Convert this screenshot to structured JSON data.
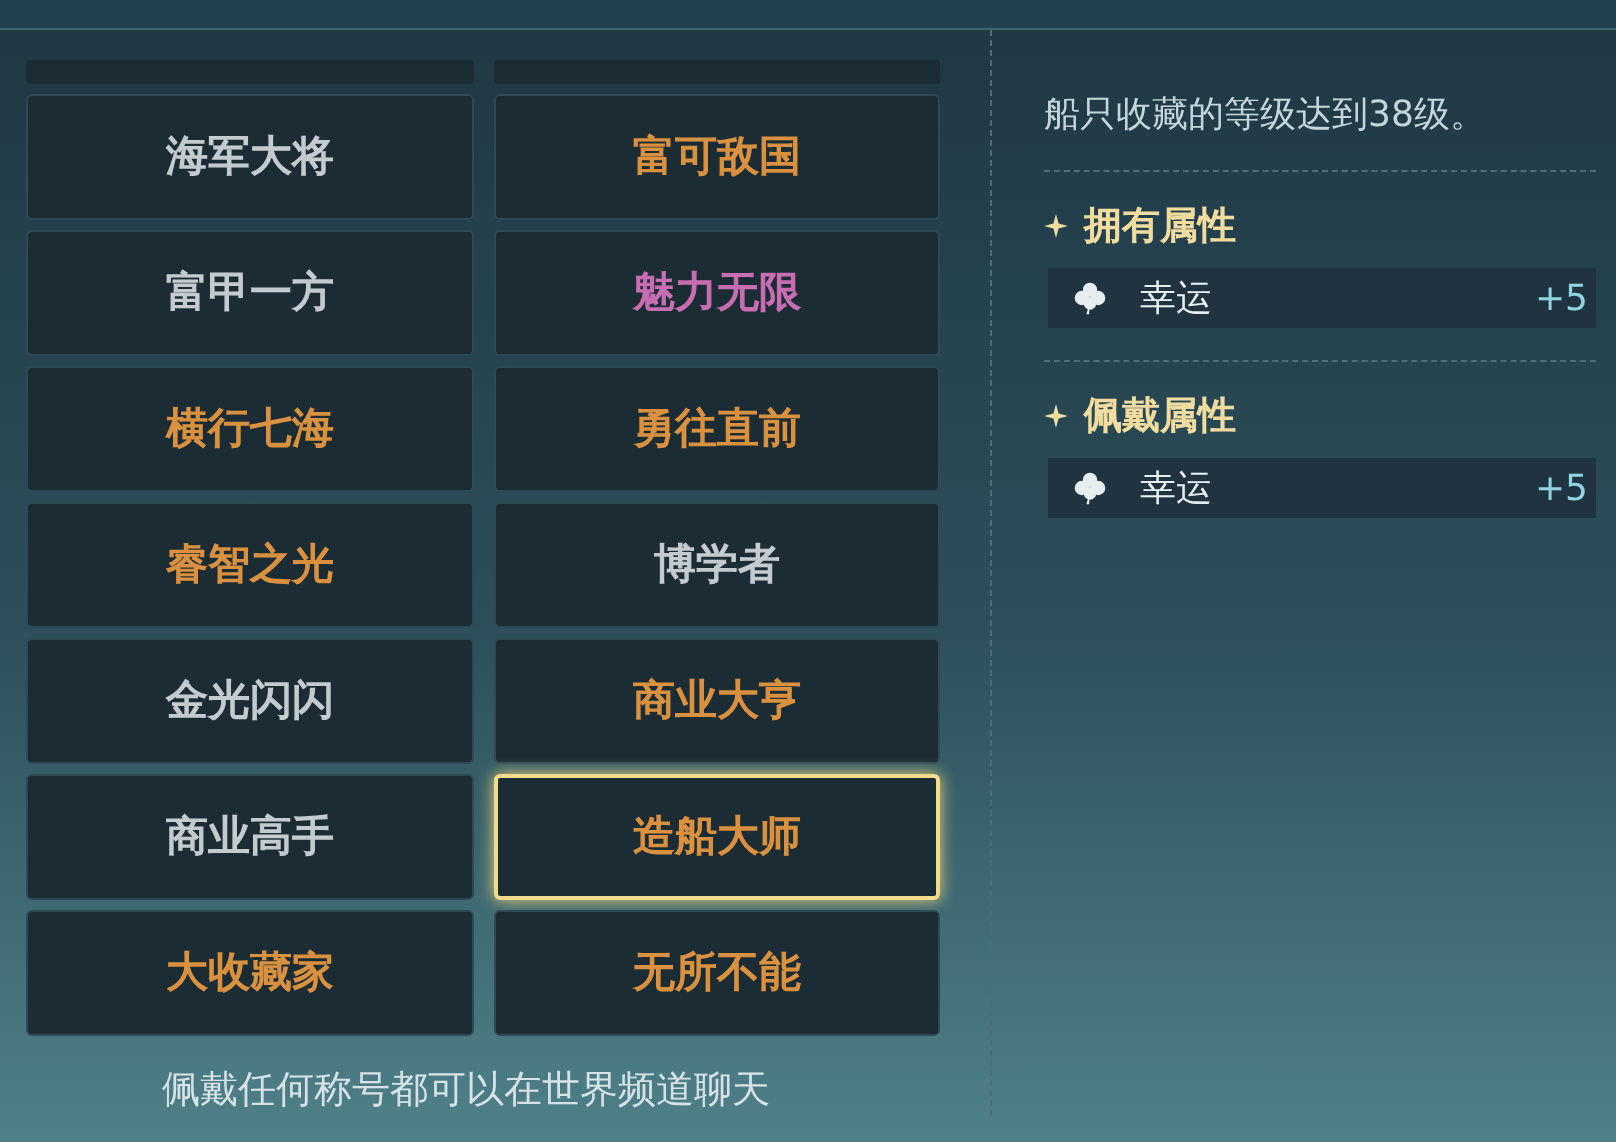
{
  "titles": [
    {
      "label": "海军大将",
      "kind": "common",
      "selected": false
    },
    {
      "label": "富可敌国",
      "kind": "legendary",
      "selected": false
    },
    {
      "label": "富甲一方",
      "kind": "common",
      "selected": false
    },
    {
      "label": "魅力无限",
      "kind": "epic",
      "selected": false
    },
    {
      "label": "横行七海",
      "kind": "legendary",
      "selected": false
    },
    {
      "label": "勇往直前",
      "kind": "legendary",
      "selected": false
    },
    {
      "label": "睿智之光",
      "kind": "legendary",
      "selected": false
    },
    {
      "label": "博学者",
      "kind": "common",
      "selected": false
    },
    {
      "label": "金光闪闪",
      "kind": "common",
      "selected": false
    },
    {
      "label": "商业大亨",
      "kind": "legendary",
      "selected": false
    },
    {
      "label": "商业高手",
      "kind": "common",
      "selected": false
    },
    {
      "label": "造船大师",
      "kind": "legendary",
      "selected": true
    },
    {
      "label": "大收藏家",
      "kind": "legendary",
      "selected": false
    },
    {
      "label": "无所不能",
      "kind": "legendary",
      "selected": false
    }
  ],
  "footer_note": "佩戴任何称号都可以在世界频道聊天",
  "detail": {
    "requirement": "船只收藏的等级达到38级。",
    "sections": [
      {
        "heading": "拥有属性",
        "attributes": [
          {
            "name": "幸运",
            "value": "+5"
          }
        ]
      },
      {
        "heading": "佩戴属性",
        "attributes": [
          {
            "name": "幸运",
            "value": "+5"
          }
        ]
      }
    ]
  }
}
